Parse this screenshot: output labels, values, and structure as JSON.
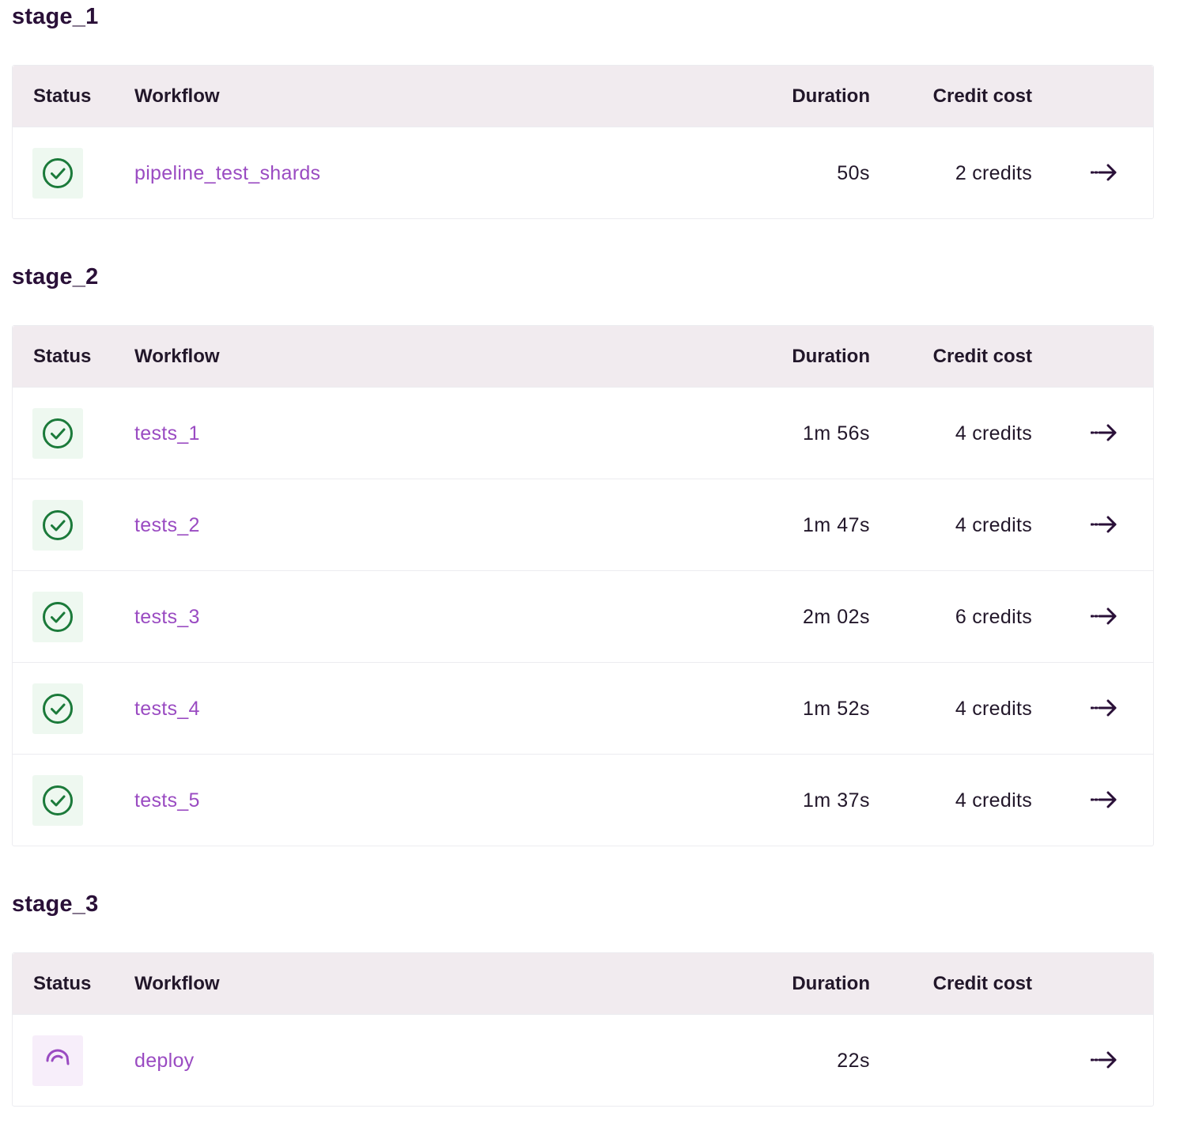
{
  "headers": {
    "status": "Status",
    "workflow": "Workflow",
    "duration": "Duration",
    "credit": "Credit cost"
  },
  "colors": {
    "success": "#1b7a3a",
    "running": "#9a4bc2",
    "link": "#9a4bc2",
    "header_bg": "#f1ebef"
  },
  "stages": [
    {
      "name": "stage_1",
      "rows": [
        {
          "status": "success",
          "status_icon": "check-circle-icon",
          "workflow": "pipeline_test_shards",
          "duration": "50s",
          "credit": "2 credits"
        }
      ]
    },
    {
      "name": "stage_2",
      "rows": [
        {
          "status": "success",
          "status_icon": "check-circle-icon",
          "workflow": "tests_1",
          "duration": "1m 56s",
          "credit": "4 credits"
        },
        {
          "status": "success",
          "status_icon": "check-circle-icon",
          "workflow": "tests_2",
          "duration": "1m 47s",
          "credit": "4 credits"
        },
        {
          "status": "success",
          "status_icon": "check-circle-icon",
          "workflow": "tests_3",
          "duration": "2m 02s",
          "credit": "6 credits"
        },
        {
          "status": "success",
          "status_icon": "check-circle-icon",
          "workflow": "tests_4",
          "duration": "1m 52s",
          "credit": "4 credits"
        },
        {
          "status": "success",
          "status_icon": "check-circle-icon",
          "workflow": "tests_5",
          "duration": "1m 37s",
          "credit": "4 credits"
        }
      ]
    },
    {
      "name": "stage_3",
      "rows": [
        {
          "status": "running",
          "status_icon": "spinner-icon",
          "workflow": "deploy",
          "duration": "22s",
          "credit": ""
        }
      ]
    }
  ]
}
